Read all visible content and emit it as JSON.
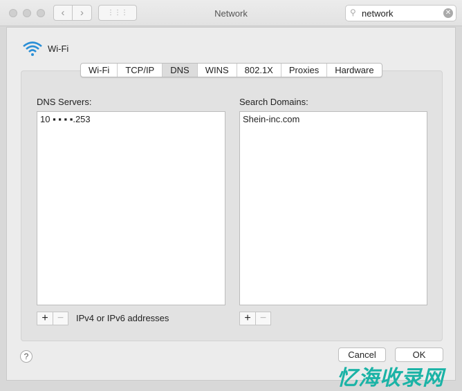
{
  "window": {
    "title": "Network",
    "search_value": "network"
  },
  "service": {
    "name": "Wi-Fi",
    "icon": "wifi-icon"
  },
  "tabs": [
    {
      "label": "Wi-Fi"
    },
    {
      "label": "TCP/IP"
    },
    {
      "label": "DNS",
      "selected": true
    },
    {
      "label": "WINS"
    },
    {
      "label": "802.1X"
    },
    {
      "label": "Proxies"
    },
    {
      "label": "Hardware"
    }
  ],
  "dns": {
    "label": "DNS Servers:",
    "servers": [
      "10 ▪ ▪ ▪ ▪.253"
    ],
    "hint": "IPv4 or IPv6 addresses"
  },
  "search_domains": {
    "label": "Search Domains:",
    "domains": [
      "Shein-inc.com"
    ]
  },
  "buttons": {
    "add": "+",
    "remove": "−",
    "help": "?",
    "cancel": "Cancel",
    "ok": "OK"
  },
  "watermark": "忆海收录网"
}
